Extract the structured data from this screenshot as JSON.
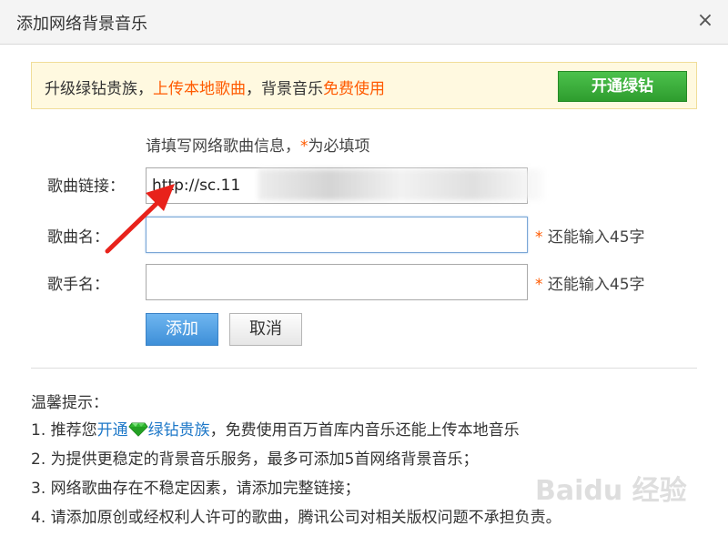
{
  "dialog": {
    "title": "添加网络背景音乐",
    "close_glyph": "×"
  },
  "promo": {
    "text_part1": "升级绿钻贵族，",
    "text_highlight1": "上传本地歌曲",
    "text_part2": "，背景音乐",
    "text_highlight2": "免费使用",
    "button_label": "开通绿钻"
  },
  "form": {
    "hint_text": "请填写网络歌曲信息，",
    "hint_star": "*",
    "hint_required": "为必填项",
    "song_link": {
      "label": "歌曲链接：",
      "value": "http://sc.11"
    },
    "song_name": {
      "label": "歌曲名：",
      "value": "",
      "star": "*",
      "remaining": "还能输入45字"
    },
    "singer_name": {
      "label": "歌手名：",
      "value": "",
      "star": "*",
      "remaining": "还能输入45字"
    },
    "add_button": "添加",
    "cancel_button": "取消"
  },
  "tips": {
    "title": "温馨提示：",
    "tip1_prefix": "1. 推荐您",
    "tip1_link1": "开通",
    "tip1_link2": "绿钻贵族",
    "tip1_suffix": "，免费使用百万首库内音乐还能上传本地音乐",
    "tip2": "2. 为提供更稳定的背景音乐服务，最多可添加5首网络背景音乐；",
    "tip3": "3. 网络歌曲存在不稳定因素，请添加完整链接；",
    "tip4": "4. 请添加原创或经权利人许可的歌曲，腾讯公司对相关版权问题不承担负责。"
  },
  "watermark": {
    "text": "Baidu 经验"
  },
  "colors": {
    "accent_orange": "#ff5a00",
    "button_green": "#2e9d2e",
    "button_blue": "#3e8fd8",
    "link_blue": "#1e78c8",
    "arrow_red": "#e8221b"
  },
  "icons": {
    "close": "close-icon",
    "gem": "green-diamond-icon",
    "arrow": "red-arrow-annotation"
  }
}
